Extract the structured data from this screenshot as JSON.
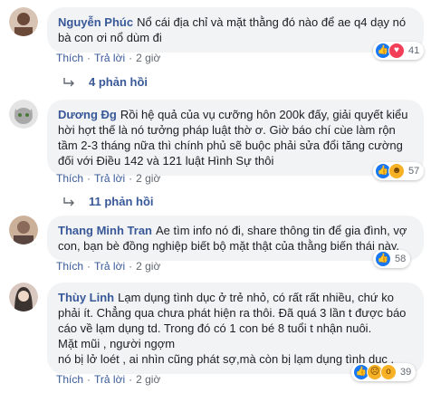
{
  "comments": [
    {
      "name": "Nguyễn Phúc",
      "text_lines": [
        "Nổ cái địa chỉ và mặt thằng đó nào để ae q4 dạy nó",
        "bà con ơi nổ dùm đi"
      ],
      "like_label": "Thích",
      "reply_label": "Trả lời",
      "time": "2 giờ",
      "reaction_count": "41",
      "replies_label": "4 phản hồi",
      "avatar_color": "#6b4a3a"
    },
    {
      "name": "Dương Đg",
      "text_lines": [
        "Rồi hệ quả của vụ cưỡng hôn 200k đấy, giải quyết kiểu",
        "hời hợt thế là nó tưởng pháp luật thờ ơ. Giờ báo chí cùe làm rộn",
        "tầm 2-3 tháng nữa thì chính phủ sẽ buộc phải sửa đổi tăng cường",
        "đối với Điều 142 và 121 luật Hình Sự thôi"
      ],
      "like_label": "Thích",
      "reply_label": "Trả lời",
      "time": "2 giờ",
      "reaction_count": "57",
      "replies_label": "11 phản hồi",
      "avatar_color": "#c9c9c9"
    },
    {
      "name": "Thang Minh Tran",
      "text_lines": [
        "Ae tìm info nó đi, share thông tin để gia đình, vợ",
        "con, bạn bè đồng nghiệp biết bộ mặt thật của thằng biến thái này."
      ],
      "like_label": "Thích",
      "reply_label": "Trả lời",
      "time": "2 giờ",
      "reaction_count": "58",
      "avatar_color": "#8a6a5a"
    },
    {
      "name": "Thùy Linh",
      "text_lines": [
        "Lạm dụng tình dục ở trẻ nhỏ, có rất rất nhiều, chứ ko",
        "phải ít. Chẳng qua chưa phát hiện ra thôi. Đã quá 3 lần t được báo",
        "cáo về lạm dụng td. Trong đó có 1 con bé 8 tuổi t nhận nuôi.",
        "Mặt mũi , người ngợm",
        "nó bị lở loét , ai nhìn cũng phát sợ,mà còn bị lạm dụng tình dục ."
      ],
      "like_label": "Thích",
      "reply_label": "Trả lời",
      "time": "2 giờ",
      "reaction_count": "39",
      "avatar_color": "#3a3330"
    }
  ]
}
